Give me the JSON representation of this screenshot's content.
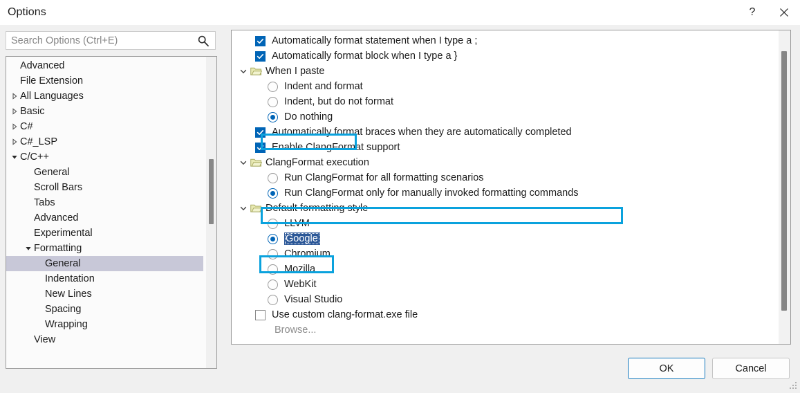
{
  "window": {
    "title": "Options",
    "help_label": "?",
    "close_label": "×"
  },
  "search": {
    "placeholder": "Search Options (Ctrl+E)",
    "value": "",
    "icon": "search-icon"
  },
  "tree": {
    "items": [
      {
        "label": "Advanced",
        "indent": 1,
        "expander": "none",
        "selected": false
      },
      {
        "label": "File Extension",
        "indent": 1,
        "expander": "none",
        "selected": false
      },
      {
        "label": "All Languages",
        "indent": 1,
        "expander": "collapsed",
        "selected": false
      },
      {
        "label": "Basic",
        "indent": 1,
        "expander": "collapsed",
        "selected": false
      },
      {
        "label": "C#",
        "indent": 1,
        "expander": "collapsed",
        "selected": false
      },
      {
        "label": "C#_LSP",
        "indent": 1,
        "expander": "collapsed",
        "selected": false
      },
      {
        "label": "C/C++",
        "indent": 1,
        "expander": "expanded",
        "selected": false
      },
      {
        "label": "General",
        "indent": 2,
        "expander": "none",
        "selected": false
      },
      {
        "label": "Scroll Bars",
        "indent": 2,
        "expander": "none",
        "selected": false
      },
      {
        "label": "Tabs",
        "indent": 2,
        "expander": "none",
        "selected": false
      },
      {
        "label": "Advanced",
        "indent": 2,
        "expander": "none",
        "selected": false
      },
      {
        "label": "Experimental",
        "indent": 2,
        "expander": "none",
        "selected": false
      },
      {
        "label": "Formatting",
        "indent": 2,
        "expander": "expanded",
        "selected": false
      },
      {
        "label": "General",
        "indent": 3,
        "expander": "none",
        "selected": true
      },
      {
        "label": "Indentation",
        "indent": 3,
        "expander": "none",
        "selected": false
      },
      {
        "label": "New Lines",
        "indent": 3,
        "expander": "none",
        "selected": false
      },
      {
        "label": "Spacing",
        "indent": 3,
        "expander": "none",
        "selected": false
      },
      {
        "label": "Wrapping",
        "indent": 3,
        "expander": "none",
        "selected": false
      },
      {
        "label": "View",
        "indent": 2,
        "expander": "none",
        "selected": false
      }
    ]
  },
  "options": {
    "rows": [
      {
        "type": "checkbox",
        "label": "Automatically format statement when I type a ;",
        "checked": true,
        "indent": 0,
        "enabled": true
      },
      {
        "type": "checkbox",
        "label": "Automatically format block when I type a }",
        "checked": true,
        "indent": 0,
        "enabled": true
      },
      {
        "type": "group",
        "label": "When I paste",
        "expanded": true,
        "indent": 0
      },
      {
        "type": "radio",
        "label": "Indent and format",
        "checked": false,
        "indent": 2,
        "enabled": true
      },
      {
        "type": "radio",
        "label": "Indent, but do not format",
        "checked": false,
        "indent": 2,
        "enabled": true
      },
      {
        "type": "radio",
        "label": "Do nothing",
        "checked": true,
        "indent": 2,
        "enabled": true
      },
      {
        "type": "checkbox",
        "label": "Automatically format braces when they are automatically completed",
        "checked": true,
        "indent": 0,
        "enabled": true
      },
      {
        "type": "checkbox",
        "label": "Enable ClangFormat support",
        "checked": true,
        "indent": 0,
        "enabled": true
      },
      {
        "type": "group",
        "label": "ClangFormat execution",
        "expanded": true,
        "indent": 0
      },
      {
        "type": "radio",
        "label": "Run ClangFormat for all formatting scenarios",
        "checked": false,
        "indent": 2,
        "enabled": true
      },
      {
        "type": "radio",
        "label": "Run ClangFormat only for manually invoked formatting commands",
        "checked": true,
        "indent": 2,
        "enabled": true
      },
      {
        "type": "group",
        "label": "Default formatting style",
        "expanded": true,
        "indent": 0
      },
      {
        "type": "radio",
        "label": "LLVM",
        "checked": false,
        "indent": 2,
        "enabled": true
      },
      {
        "type": "radio",
        "label": "Google",
        "checked": true,
        "indent": 2,
        "enabled": true,
        "selected": true
      },
      {
        "type": "radio",
        "label": "Chromium",
        "checked": false,
        "indent": 2,
        "enabled": true
      },
      {
        "type": "radio",
        "label": "Mozilla",
        "checked": false,
        "indent": 2,
        "enabled": true
      },
      {
        "type": "radio",
        "label": "WebKit",
        "checked": false,
        "indent": 2,
        "enabled": true
      },
      {
        "type": "radio",
        "label": "Visual Studio",
        "checked": false,
        "indent": 2,
        "enabled": true
      },
      {
        "type": "checkbox",
        "label": "Use custom clang-format.exe file",
        "checked": false,
        "indent": 0,
        "enabled": true
      },
      {
        "type": "link",
        "label": "Browse...",
        "indent": 0,
        "enabled": false
      }
    ]
  },
  "footer": {
    "ok_label": "OK",
    "cancel_label": "Cancel"
  },
  "colors": {
    "accent": "#0064b6",
    "annotation": "#0aa2dd",
    "selection": "#2b5797",
    "tree_selection": "#c8c8d8"
  }
}
